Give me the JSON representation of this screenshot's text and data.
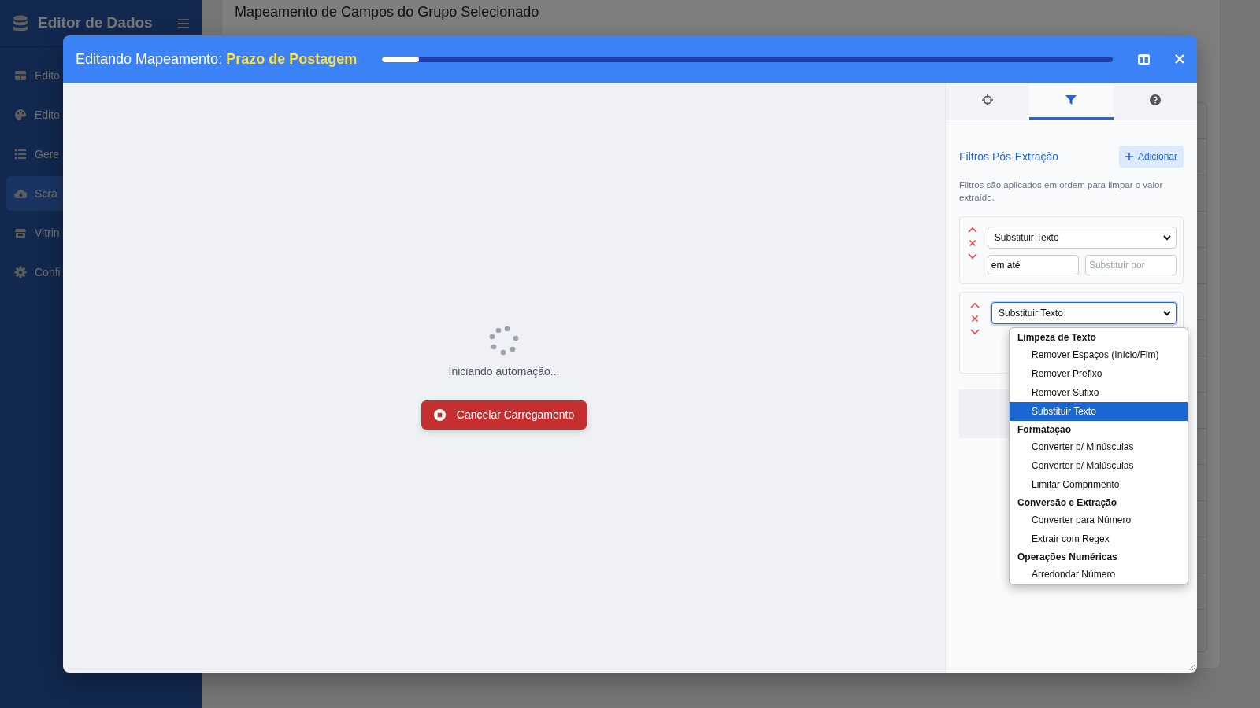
{
  "sidebar": {
    "brand": "Editor de Dados",
    "items": [
      {
        "label": "Edito",
        "selected": false
      },
      {
        "label": "Edito",
        "selected": false
      },
      {
        "label": "Gere",
        "selected": false
      },
      {
        "label": "Scra",
        "selected": true
      },
      {
        "label": "Vitrin",
        "selected": false
      },
      {
        "label": "Confi",
        "selected": false
      }
    ]
  },
  "page": {
    "heading": "Mapeamento de Campos do Grupo Selecionado"
  },
  "modal": {
    "title_prefix": "Editando Mapeamento:",
    "title_field": "Prazo de Postagem",
    "progress": {
      "level": 0.05
    },
    "loading": {
      "message": "Iniciando automação...",
      "cancel_button": "Cancelar Carregamento"
    },
    "tabs": [
      {
        "selected": false
      },
      {
        "selected": true
      },
      {
        "selected": false
      }
    ],
    "filters_panel": {
      "title": "Filtros Pós-Extração",
      "add_button": "Adicionar",
      "description": "Filtros são aplicados em ordem para limpar o valor extraído.",
      "filters": [
        {
          "type": "Substituir Texto",
          "focused": false,
          "find_value": "em até",
          "replace_placeholder": "Substituir por"
        },
        {
          "type": "Substituir Texto",
          "focused": true
        }
      ],
      "dropdown": {
        "groups": [
          {
            "label": "Limpeza de Texto",
            "options": [
              {
                "label": "Remover Espaços (Início/Fim)",
                "selected": false
              },
              {
                "label": "Remover Prefixo",
                "selected": false
              },
              {
                "label": "Remover Sufixo",
                "selected": false
              },
              {
                "label": "Substituir Texto",
                "selected": true
              }
            ]
          },
          {
            "label": "Formatação",
            "options": [
              {
                "label": "Converter p/ Minúsculas",
                "selected": false
              },
              {
                "label": "Converter p/ Maiúsculas",
                "selected": false
              },
              {
                "label": "Limitar Comprimento",
                "selected": false
              }
            ]
          },
          {
            "label": "Conversão e Extração",
            "options": [
              {
                "label": "Converter para Número",
                "selected": false
              },
              {
                "label": "Extrair com Regex",
                "selected": false
              }
            ]
          },
          {
            "label": "Operações Numéricas",
            "options": [
              {
                "label": "Arredondar Número",
                "selected": false
              }
            ]
          }
        ]
      }
    }
  }
}
